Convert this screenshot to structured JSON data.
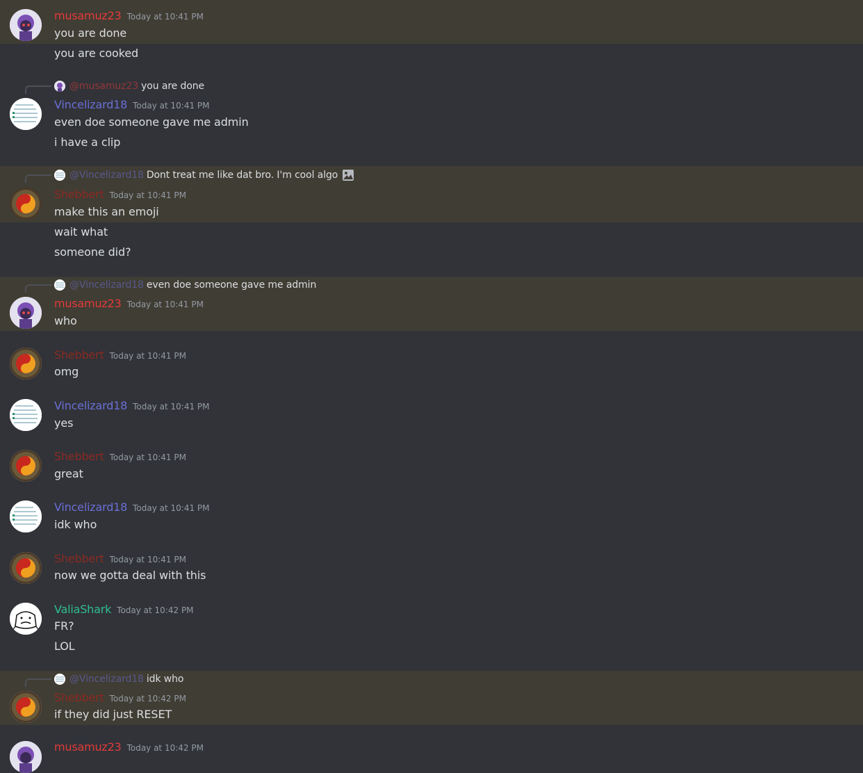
{
  "users": {
    "musamuz23": {
      "name": "musamuz23",
      "color": "#e33a3a"
    },
    "vincelizard18": {
      "name": "Vincelizard18",
      "color": "#6b6fd6"
    },
    "shebbert": {
      "name": "Shebbert",
      "color": "#8a2a22"
    },
    "valiashark": {
      "name": "ValiaShark",
      "color": "#2fbf8f"
    }
  },
  "messages": [
    {
      "user": "musamuz23",
      "timestamp": "Today at 10:41 PM",
      "lines": [
        "you are done",
        "you are cooked"
      ]
    },
    {
      "user": "Vincelizard18",
      "timestamp": "Today at 10:41 PM",
      "reply": {
        "mention": "@musamuz23",
        "text": "you are done"
      },
      "lines": [
        "even doe someone gave me admin",
        "i have a clip"
      ]
    },
    {
      "user": "Shebbert",
      "timestamp": "Today at 10:41 PM",
      "reply": {
        "mention": "@Vincelizard18",
        "text": "Dont treat me like dat bro. I'm cool algo",
        "icon": "image-icon"
      },
      "lines": [
        "make this an emoji",
        "wait what",
        "someone did?"
      ]
    },
    {
      "user": "musamuz23",
      "timestamp": "Today at 10:41 PM",
      "reply": {
        "mention": "@Vincelizard18",
        "text": "even doe someone gave me admin"
      },
      "lines": [
        "who"
      ]
    },
    {
      "user": "Shebbert",
      "timestamp": "Today at 10:41 PM",
      "lines": [
        "omg"
      ]
    },
    {
      "user": "Vincelizard18",
      "timestamp": "Today at 10:41 PM",
      "lines": [
        "yes"
      ]
    },
    {
      "user": "Shebbert",
      "timestamp": "Today at 10:41 PM",
      "lines": [
        "great"
      ]
    },
    {
      "user": "Vincelizard18",
      "timestamp": "Today at 10:41 PM",
      "lines": [
        "idk who"
      ]
    },
    {
      "user": "Shebbert",
      "timestamp": "Today at 10:41 PM",
      "lines": [
        "now we gotta deal with this"
      ]
    },
    {
      "user": "ValiaShark",
      "timestamp": "Today at 10:42 PM",
      "lines": [
        "FR?",
        "LOL"
      ]
    },
    {
      "user": "Shebbert",
      "timestamp": "Today at 10:42 PM",
      "reply": {
        "mention": "@Vincelizard18",
        "text": "idk who"
      },
      "lines": [
        "if they did just RESET"
      ]
    },
    {
      "user": "musamuz23",
      "timestamp": "Today at 10:42 PM",
      "lines": []
    }
  ]
}
